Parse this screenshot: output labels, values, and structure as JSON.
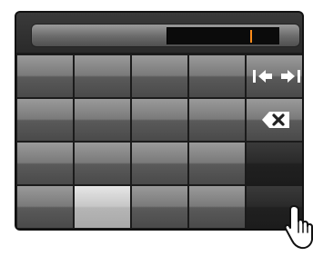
{
  "screen": {
    "title_text": "",
    "input_value": "",
    "cursor_color": "#ff8c1a"
  },
  "keyboard": {
    "grid": [
      [
        {
          "label": ""
        },
        {
          "label": ""
        },
        {
          "label": ""
        },
        {
          "label": ""
        },
        {
          "label": "",
          "icon": "cursor-left-right-icons"
        }
      ],
      [
        {
          "label": ""
        },
        {
          "label": ""
        },
        {
          "label": ""
        },
        {
          "label": ""
        },
        {
          "label": "",
          "icon": "backspace-icon"
        }
      ],
      [
        {
          "label": ""
        },
        {
          "label": ""
        },
        {
          "label": ""
        },
        {
          "label": ""
        },
        {
          "label": ""
        }
      ],
      [
        {
          "label": ""
        },
        {
          "label": "",
          "state": "pressed"
        },
        {
          "label": ""
        },
        {
          "label": ""
        },
        {
          "label": ""
        }
      ]
    ]
  },
  "icons": {
    "left": "cursor-left-icon",
    "right": "cursor-right-icon",
    "delete": "delete-icon",
    "hand": "hand-pointer-icon"
  },
  "colors": {
    "panel": "#1a1a1a",
    "key_light": "#8a8a8a",
    "key_pressed": "#c9c9c9",
    "key_dark": "#2a2a2a",
    "accent": "#ff8c1a"
  }
}
